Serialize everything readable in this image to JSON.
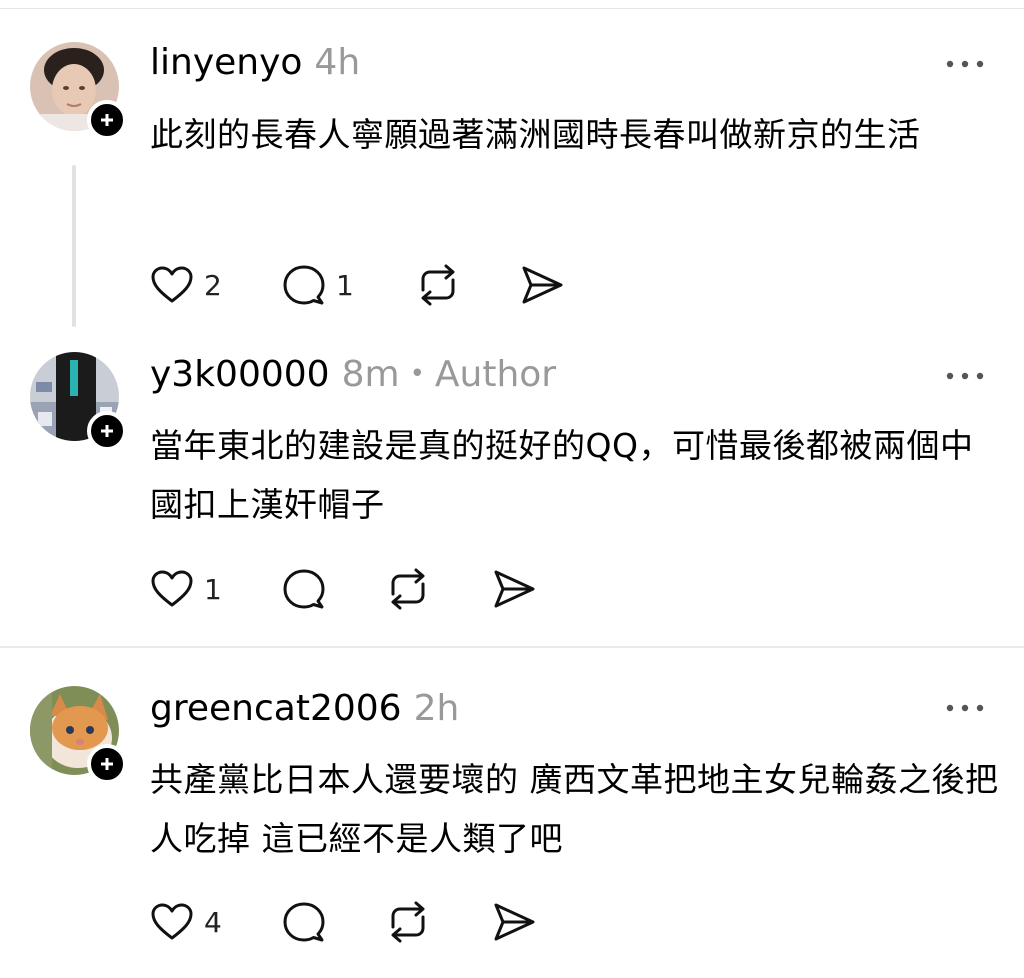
{
  "posts": [
    {
      "username": "linyenyo",
      "time": "4h",
      "author_tag": "",
      "text": "此刻的長春人寧願過著滿洲國時長春叫做新京的生活",
      "likes": "2",
      "replies": "1"
    },
    {
      "username": "y3k00000",
      "time": "8m",
      "separator": "•",
      "author_tag": "Author",
      "text": "當年東北的建設是真的挺好的QQ，可惜最後都被兩個中國扣上漢奸帽子",
      "likes": "1",
      "replies": ""
    },
    {
      "username": "greencat2006",
      "time": "2h",
      "author_tag": "",
      "text": "共產黨比日本人還要壞的 廣西文革把地主女兒輪姦之後把人吃掉 這已經不是人類了吧",
      "likes": "4",
      "replies": ""
    }
  ],
  "icons": {
    "like": "heart-icon",
    "reply": "comment-icon",
    "repost": "repost-icon",
    "share": "send-icon",
    "more": "more-icon",
    "follow": "plus-icon"
  }
}
